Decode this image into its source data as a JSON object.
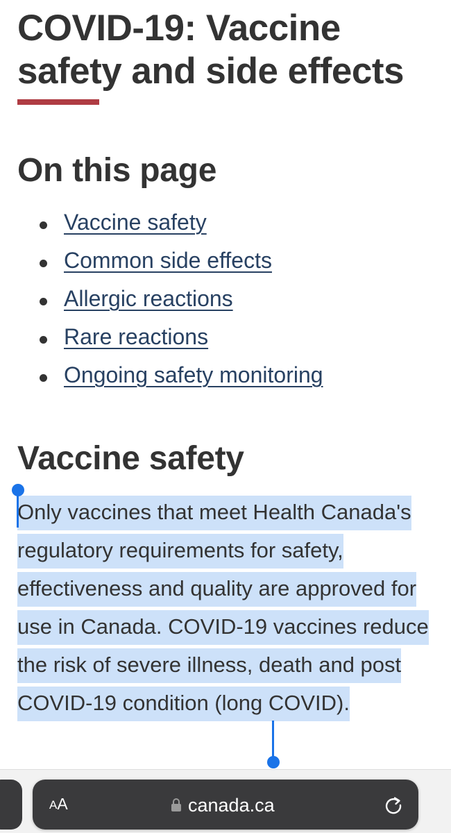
{
  "page": {
    "title": "COVID-19: Vaccine safety and side effects",
    "accent_color": "#af3c43",
    "link_color": "#284162"
  },
  "toc": {
    "heading": "On this page",
    "items": [
      {
        "label": "Vaccine safety"
      },
      {
        "label": "Common side effects"
      },
      {
        "label": "Allergic reactions"
      },
      {
        "label": "Rare reactions"
      },
      {
        "label": "Ongoing safety monitoring"
      }
    ]
  },
  "vaccine_safety": {
    "heading": "Vaccine safety",
    "paragraph": "Only vaccines that meet Health Canada's regulatory requirements for safety, effectiveness and quality are approved for use in Canada. COVID-19 vaccines reduce the risk of severe illness, death and post COVID-19 condition (long COVID).",
    "selection_color": "#cde1f9",
    "selection_handle_color": "#1a73e8"
  },
  "browser": {
    "text_size_small": "A",
    "text_size_large": "A",
    "url": "canada.ca",
    "lock_icon": "lock-icon",
    "reload_icon": "reload-icon"
  }
}
